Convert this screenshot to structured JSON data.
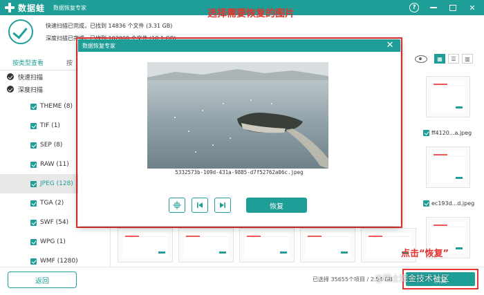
{
  "app": {
    "logo_text": "数据蛙",
    "subtitle": "数据恢复专家"
  },
  "status": {
    "quick_scan": "快速扫描已完成，已找到 14836 个文件 (3.31 GB)",
    "deep_scan": "深度扫描已完成，已找到 102000 个文件 (10.1 GB)"
  },
  "annotation": {
    "headline": "选择需要恢复的图片",
    "hint": "点击“恢复”"
  },
  "tabs": [
    {
      "label": "按类型查看"
    },
    {
      "label": "按"
    }
  ],
  "groups": [
    {
      "label": "快速扫描"
    },
    {
      "label": "深度扫描"
    }
  ],
  "types": [
    {
      "label": "THEME (8)"
    },
    {
      "label": "TIF (1)"
    },
    {
      "label": "SEP (8)"
    },
    {
      "label": "RAW (11)"
    },
    {
      "label": "JPEG (128)"
    },
    {
      "label": "TGA (2)"
    },
    {
      "label": "SWF (54)"
    },
    {
      "label": "WPG (1)"
    },
    {
      "label": "WMF (1280)"
    }
  ],
  "thumbs": [
    {
      "label": "ff4120...a.jpeg"
    },
    {
      "label": "ec193d...d.jpeg"
    }
  ],
  "bottom": {
    "back": "返回",
    "selected": "已选择 35655个项目 / 2.54 GB",
    "recover": "恢复",
    "watermark": "@稀土掘金技术社区"
  },
  "dialog": {
    "title": "数据恢复专家",
    "filename": "5332573b-109d-431a-9885-d7f52762a06c.jpeg",
    "recover": "恢复"
  },
  "colors": {
    "accent": "#1f9e97",
    "annotation": "#e3342f"
  }
}
